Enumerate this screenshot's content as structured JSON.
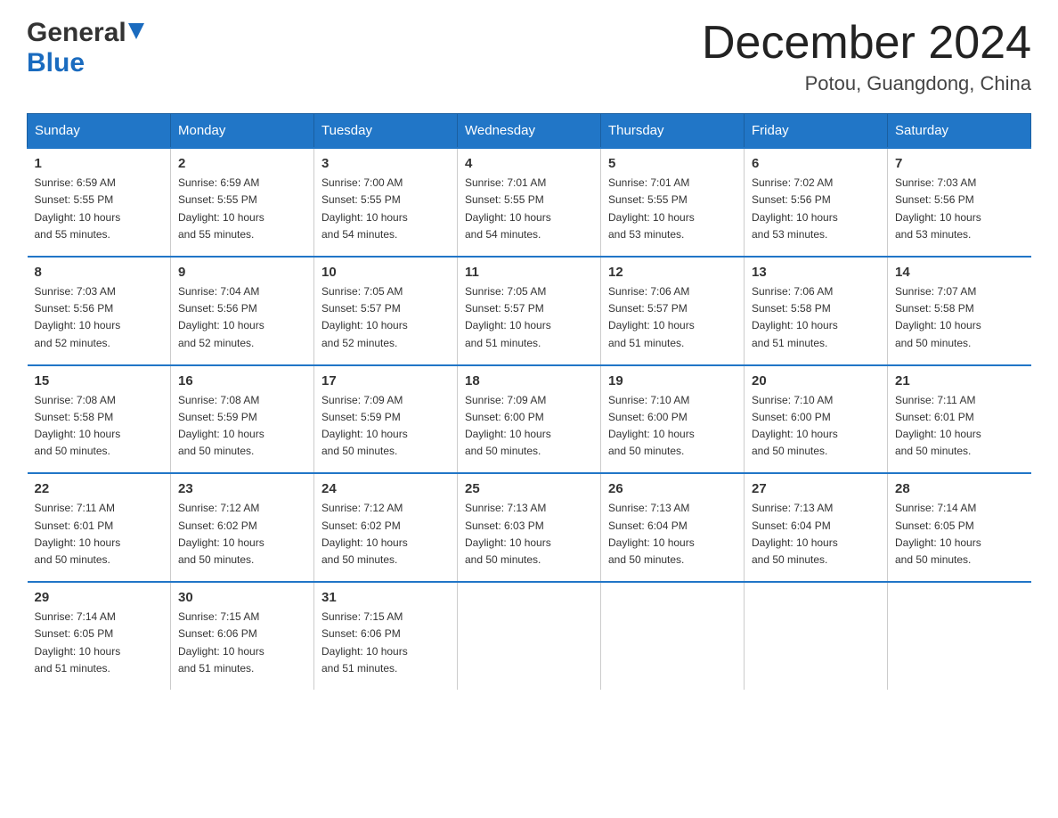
{
  "header": {
    "logo_general": "General",
    "logo_blue": "Blue",
    "month_title": "December 2024",
    "location": "Potou, Guangdong, China"
  },
  "days_of_week": [
    "Sunday",
    "Monday",
    "Tuesday",
    "Wednesday",
    "Thursday",
    "Friday",
    "Saturday"
  ],
  "weeks": [
    [
      {
        "day": "1",
        "sunrise": "6:59 AM",
        "sunset": "5:55 PM",
        "daylight": "10 hours and 55 minutes."
      },
      {
        "day": "2",
        "sunrise": "6:59 AM",
        "sunset": "5:55 PM",
        "daylight": "10 hours and 55 minutes."
      },
      {
        "day": "3",
        "sunrise": "7:00 AM",
        "sunset": "5:55 PM",
        "daylight": "10 hours and 54 minutes."
      },
      {
        "day": "4",
        "sunrise": "7:01 AM",
        "sunset": "5:55 PM",
        "daylight": "10 hours and 54 minutes."
      },
      {
        "day": "5",
        "sunrise": "7:01 AM",
        "sunset": "5:55 PM",
        "daylight": "10 hours and 53 minutes."
      },
      {
        "day": "6",
        "sunrise": "7:02 AM",
        "sunset": "5:56 PM",
        "daylight": "10 hours and 53 minutes."
      },
      {
        "day": "7",
        "sunrise": "7:03 AM",
        "sunset": "5:56 PM",
        "daylight": "10 hours and 53 minutes."
      }
    ],
    [
      {
        "day": "8",
        "sunrise": "7:03 AM",
        "sunset": "5:56 PM",
        "daylight": "10 hours and 52 minutes."
      },
      {
        "day": "9",
        "sunrise": "7:04 AM",
        "sunset": "5:56 PM",
        "daylight": "10 hours and 52 minutes."
      },
      {
        "day": "10",
        "sunrise": "7:05 AM",
        "sunset": "5:57 PM",
        "daylight": "10 hours and 52 minutes."
      },
      {
        "day": "11",
        "sunrise": "7:05 AM",
        "sunset": "5:57 PM",
        "daylight": "10 hours and 51 minutes."
      },
      {
        "day": "12",
        "sunrise": "7:06 AM",
        "sunset": "5:57 PM",
        "daylight": "10 hours and 51 minutes."
      },
      {
        "day": "13",
        "sunrise": "7:06 AM",
        "sunset": "5:58 PM",
        "daylight": "10 hours and 51 minutes."
      },
      {
        "day": "14",
        "sunrise": "7:07 AM",
        "sunset": "5:58 PM",
        "daylight": "10 hours and 50 minutes."
      }
    ],
    [
      {
        "day": "15",
        "sunrise": "7:08 AM",
        "sunset": "5:58 PM",
        "daylight": "10 hours and 50 minutes."
      },
      {
        "day": "16",
        "sunrise": "7:08 AM",
        "sunset": "5:59 PM",
        "daylight": "10 hours and 50 minutes."
      },
      {
        "day": "17",
        "sunrise": "7:09 AM",
        "sunset": "5:59 PM",
        "daylight": "10 hours and 50 minutes."
      },
      {
        "day": "18",
        "sunrise": "7:09 AM",
        "sunset": "6:00 PM",
        "daylight": "10 hours and 50 minutes."
      },
      {
        "day": "19",
        "sunrise": "7:10 AM",
        "sunset": "6:00 PM",
        "daylight": "10 hours and 50 minutes."
      },
      {
        "day": "20",
        "sunrise": "7:10 AM",
        "sunset": "6:00 PM",
        "daylight": "10 hours and 50 minutes."
      },
      {
        "day": "21",
        "sunrise": "7:11 AM",
        "sunset": "6:01 PM",
        "daylight": "10 hours and 50 minutes."
      }
    ],
    [
      {
        "day": "22",
        "sunrise": "7:11 AM",
        "sunset": "6:01 PM",
        "daylight": "10 hours and 50 minutes."
      },
      {
        "day": "23",
        "sunrise": "7:12 AM",
        "sunset": "6:02 PM",
        "daylight": "10 hours and 50 minutes."
      },
      {
        "day": "24",
        "sunrise": "7:12 AM",
        "sunset": "6:02 PM",
        "daylight": "10 hours and 50 minutes."
      },
      {
        "day": "25",
        "sunrise": "7:13 AM",
        "sunset": "6:03 PM",
        "daylight": "10 hours and 50 minutes."
      },
      {
        "day": "26",
        "sunrise": "7:13 AM",
        "sunset": "6:04 PM",
        "daylight": "10 hours and 50 minutes."
      },
      {
        "day": "27",
        "sunrise": "7:13 AM",
        "sunset": "6:04 PM",
        "daylight": "10 hours and 50 minutes."
      },
      {
        "day": "28",
        "sunrise": "7:14 AM",
        "sunset": "6:05 PM",
        "daylight": "10 hours and 50 minutes."
      }
    ],
    [
      {
        "day": "29",
        "sunrise": "7:14 AM",
        "sunset": "6:05 PM",
        "daylight": "10 hours and 51 minutes."
      },
      {
        "day": "30",
        "sunrise": "7:15 AM",
        "sunset": "6:06 PM",
        "daylight": "10 hours and 51 minutes."
      },
      {
        "day": "31",
        "sunrise": "7:15 AM",
        "sunset": "6:06 PM",
        "daylight": "10 hours and 51 minutes."
      },
      null,
      null,
      null,
      null
    ]
  ],
  "labels": {
    "sunrise": "Sunrise:",
    "sunset": "Sunset:",
    "daylight": "Daylight:"
  }
}
